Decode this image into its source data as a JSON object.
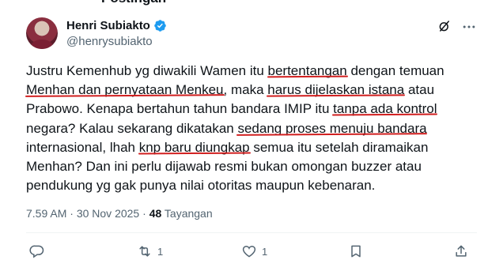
{
  "top_fragment": "Postingan",
  "author": {
    "display_name": "Henri Subiakto",
    "handle": "@henrysubiakto"
  },
  "tweet": {
    "lines": [
      [
        "Justru Kemenhub yg diwakili Wamen itu ",
        "bertentangan",
        " dengan temuan"
      ],
      [
        "",
        "Menhan dan pernyataan Menkeu",
        ", maka ",
        "harus dijelaskan istana",
        " atau"
      ],
      [
        "Prabowo. Kenapa bertahun tahun bandara IMIP itu ",
        "tanpa ada kontrol"
      ],
      [
        "negara? Kalau sekarang dikatakan ",
        "sedang proses menuju bandara"
      ],
      [
        "internasional, lhah ",
        "knp baru diungkap",
        " semua itu setelah diramaikan"
      ],
      [
        "Menhan? Dan ini perlu dijawab resmi bukan omongan buzzer atau"
      ],
      [
        "pendukung yg gak punya nilai otoritas maupun kebenaran."
      ]
    ]
  },
  "meta": {
    "time": "7.59 AM",
    "separator1": " · ",
    "date": "30 Nov 2025",
    "separator2": " · ",
    "views": "48",
    "views_label": " Tayangan"
  },
  "actions": {
    "reply_count": "",
    "retweet_count": "1",
    "like_count": "1",
    "bookmark_count": "",
    "share_count": ""
  },
  "colors": {
    "text": "#0f1419",
    "secondary": "#536471",
    "verified": "#1d9bf0",
    "underline": "#d11f1f"
  }
}
